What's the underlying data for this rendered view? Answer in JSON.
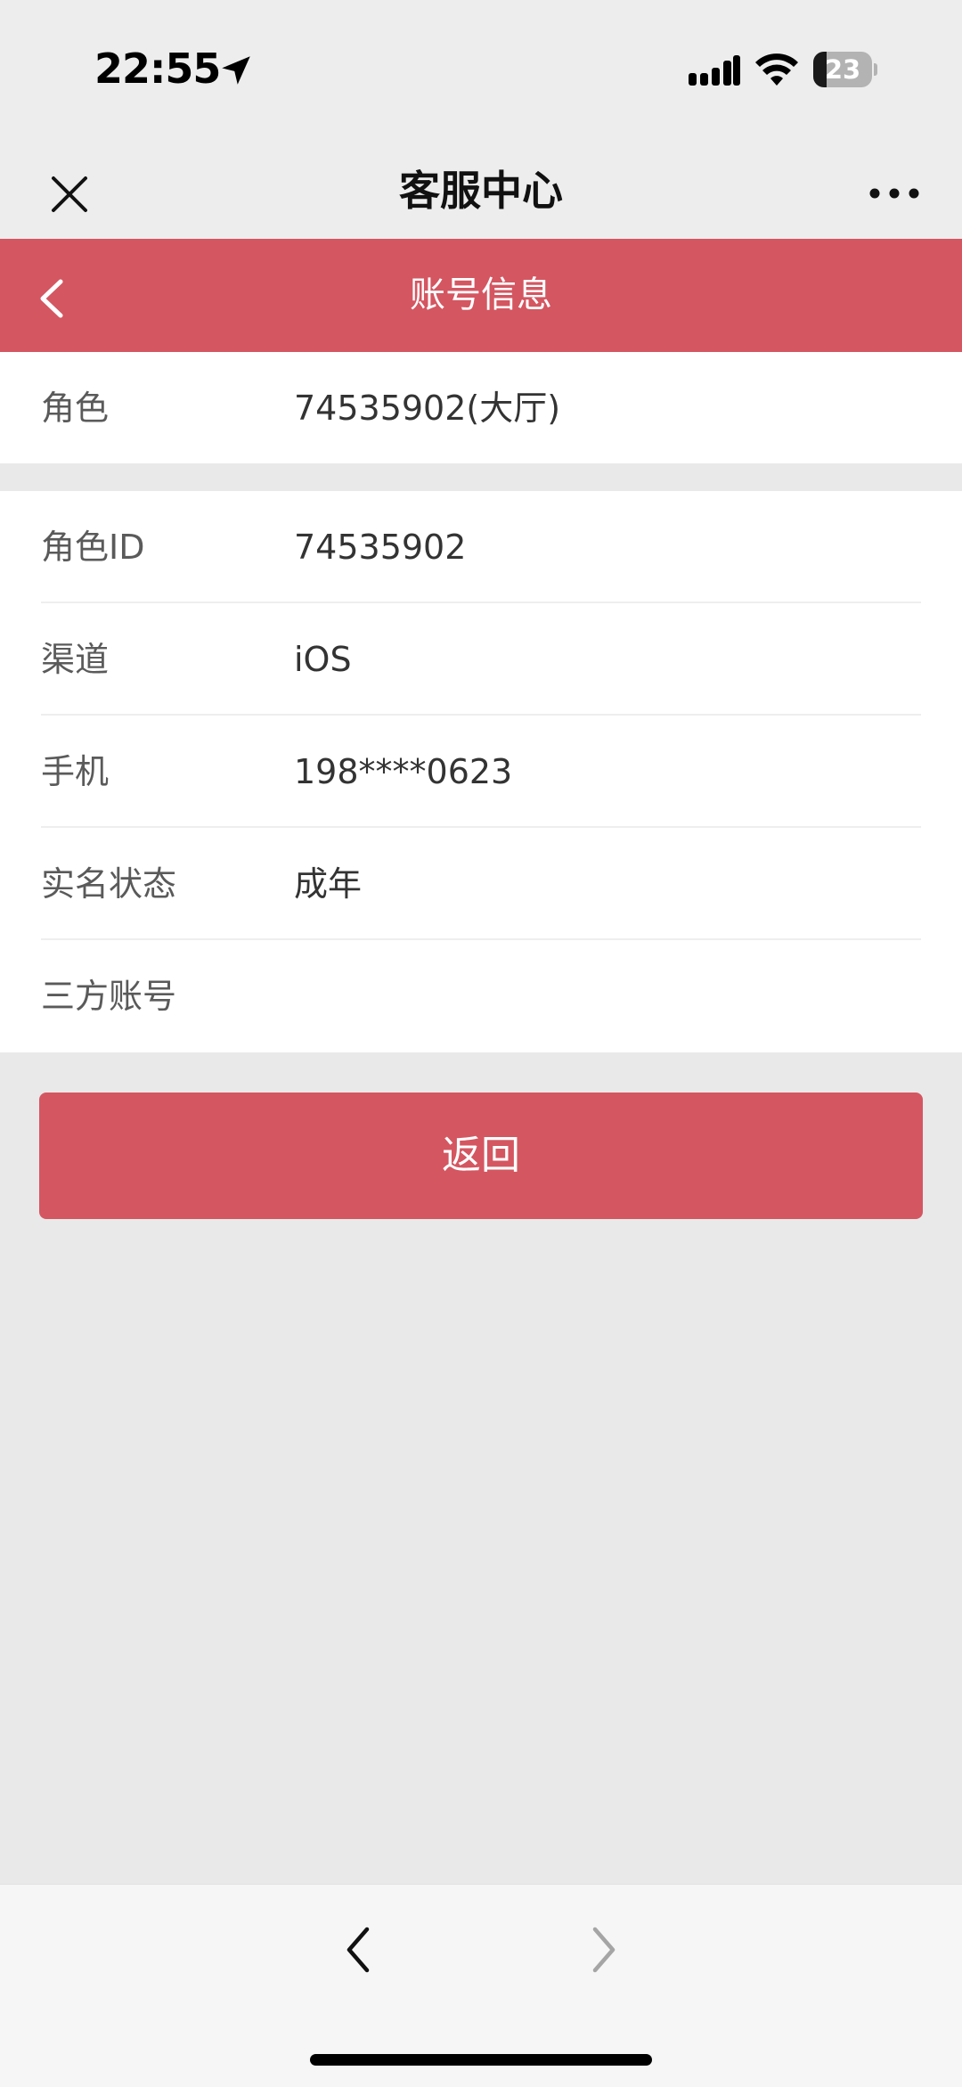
{
  "status_bar": {
    "time": "22:55",
    "battery_percent": "23",
    "battery_level": 0.23,
    "icons": [
      "location-arrow-icon",
      "signal-icon",
      "wifi-icon",
      "battery-icon"
    ]
  },
  "nav": {
    "title": "客服中心",
    "close_icon": "close-icon",
    "more_icon": "more-icon"
  },
  "page": {
    "title": "账号信息",
    "back_icon": "chevron-left-icon"
  },
  "role_card": {
    "label": "角色",
    "value": "74535902(大厅)"
  },
  "details": [
    {
      "label": "角色ID",
      "value": "74535902"
    },
    {
      "label": "渠道",
      "value": "iOS"
    },
    {
      "label": "手机",
      "value": "198****0623"
    },
    {
      "label": "实名状态",
      "value": "成年"
    },
    {
      "label": "三方账号",
      "value": ""
    }
  ],
  "actions": {
    "return_label": "返回"
  },
  "bottom_bar": {
    "back_icon": "chevron-left-icon",
    "forward_icon": "chevron-right-icon"
  },
  "colors": {
    "accent": "#d45661",
    "background": "#e9e9e9",
    "nav_background": "#ededed"
  }
}
